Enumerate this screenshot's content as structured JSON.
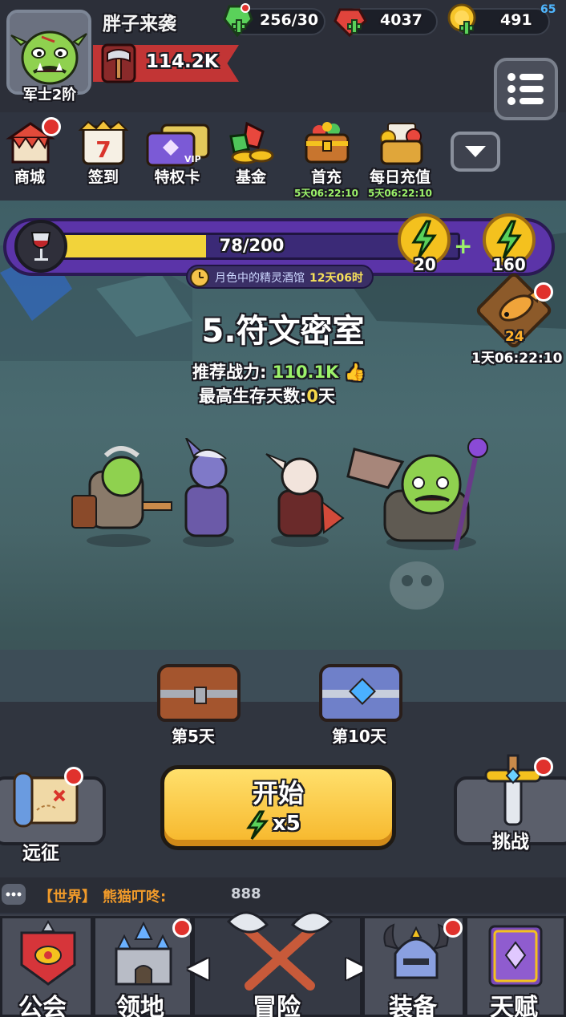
{
  "hud": {
    "fps": "65",
    "player": {
      "name": "胖子来袭",
      "rank": "军士2阶",
      "power": "114.2K"
    },
    "resources": [
      {
        "icon": "energy-gem-icon",
        "value": "256/30"
      },
      {
        "icon": "red-ruby-icon",
        "value": "4037"
      },
      {
        "icon": "gold-coin-icon",
        "value": "491"
      }
    ]
  },
  "shortcuts": [
    {
      "label": "商城",
      "timer": "",
      "badge": true
    },
    {
      "label": "签到",
      "timer": "",
      "badge": false,
      "calendar_day": "7"
    },
    {
      "label": "特权卡",
      "timer": "",
      "badge": false
    },
    {
      "label": "基金",
      "timer": "",
      "badge": false
    },
    {
      "label": "首充",
      "timer": "5天06:22:10",
      "badge": false
    },
    {
      "label": "每日充值",
      "timer": "5天06:22:10",
      "badge": false
    }
  ],
  "energy": {
    "current": 78,
    "max": 200,
    "text": "78/200",
    "orb_1": "20",
    "orb_2": "160",
    "plus": "+"
  },
  "event": {
    "name": "月色中的精灵酒馆",
    "time": "12天06时"
  },
  "fish_event": {
    "count": "24",
    "timer": "1天06:22:10"
  },
  "stage": {
    "title": "5.符文密室",
    "recommend_label": "推荐战力:",
    "recommend_value": "110.1K",
    "best_label": "最高生存天数:",
    "best_value": "0",
    "best_unit": "天"
  },
  "chests": [
    {
      "label": "第5天",
      "color": "#a4552e"
    },
    {
      "label": "第10天",
      "color": "#6f80c9"
    }
  ],
  "actions": {
    "expedition": "远征",
    "start": "开始",
    "start_cost": "x5",
    "challenge": "挑战"
  },
  "chat": {
    "channel": "【世界】",
    "user": "熊猫叮咚:",
    "message": "888"
  },
  "nav": {
    "guild": "公会",
    "territory": "领地",
    "adventure": "冒险",
    "equipment": "装备",
    "talent": "天赋"
  },
  "colors": {
    "accent_green": "#9cf26a",
    "energy_purple": "#5b34a8",
    "start_yellow": "#f6b62a",
    "badge_red": "#e0322d"
  }
}
